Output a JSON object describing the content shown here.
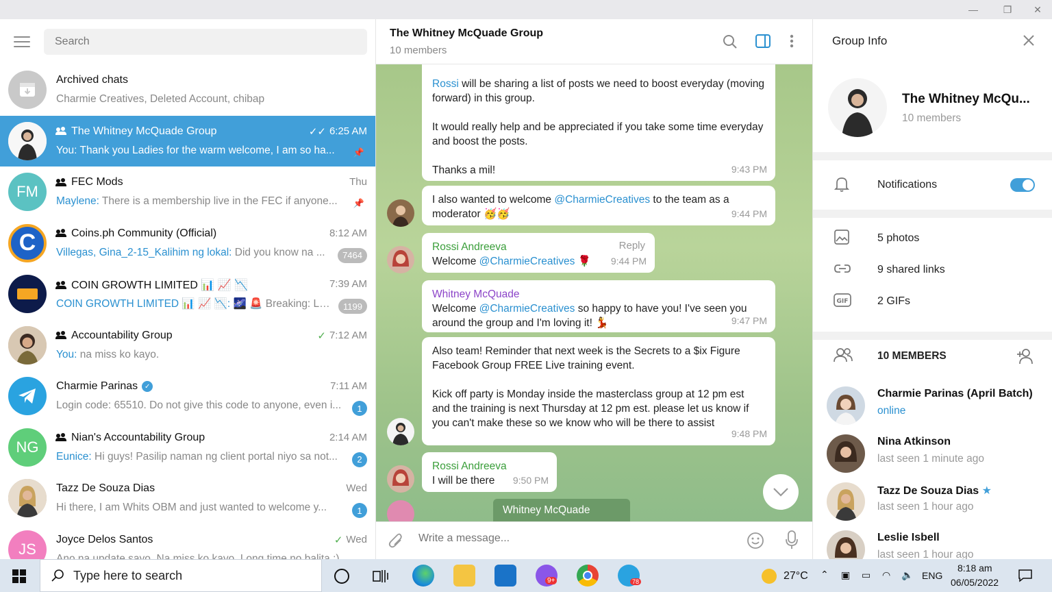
{
  "window": {
    "minimize": "—",
    "maximize": "❐",
    "close": "✕"
  },
  "left": {
    "search_placeholder": "Search",
    "chats": [
      {
        "title": "Archived chats",
        "preview": "Charmie Creatives, Deleted Account, chibap",
        "time": "",
        "badge": "",
        "sender": ""
      },
      {
        "title": "The Whitney McQuade Group",
        "preview": "Thank you Ladies for the warm welcome, I am so ha...",
        "sender": "You: ",
        "time": "6:25 AM",
        "badge": ""
      },
      {
        "title": "FEC Mods",
        "sender": "Maylene: ",
        "preview": "There is a membership live in the FEC if anyone...",
        "time": "Thu",
        "badge": "",
        "avatar_text": "FM"
      },
      {
        "title": "Coins.ph Community (Official)",
        "sender": "Villegas, Gina_2-15_Kalihim ng lokal: ",
        "preview": "Did you know na ...",
        "time": "8:12 AM",
        "badge": "7464"
      },
      {
        "title": "COIN GROWTH LIMITED 📊 📈 📉",
        "sender": "COIN GROWTH LIMITED 📊 📈 📉: ",
        "preview": "🌌 🚨 Breaking: Lu...",
        "time": "7:39 AM",
        "badge": "1199"
      },
      {
        "title": "Accountability Group",
        "sender": "You: ",
        "preview": "na miss ko kayo.",
        "time": "7:12 AM",
        "badge": ""
      },
      {
        "title": "Charmie Parinas",
        "sender": "",
        "preview": "Login code: 65510. Do not give this code to anyone, even i...",
        "time": "7:11 AM",
        "badge": "1"
      },
      {
        "title": "Nian's Accountability Group",
        "sender": "Eunice: ",
        "preview": "Hi guys! Pasilip naman ng client portal niyo sa not...",
        "time": "2:14 AM",
        "badge": "2",
        "avatar_text": "NG"
      },
      {
        "title": "Tazz De Souza Dias",
        "sender": "",
        "preview": "Hi there,   I am Whits OBM and just wanted to welcome y...",
        "time": "Wed",
        "badge": "1"
      },
      {
        "title": "Joyce Delos Santos",
        "sender": "",
        "preview": "Ano na update sayo. Na miss ko kayo. Long time no balita :)",
        "time": "Wed",
        "badge": "",
        "avatar_text": "JS"
      }
    ]
  },
  "middle": {
    "title": "The Whitney McQuade Group",
    "subtitle": "10 members",
    "messages": [
      {
        "mention": "Rossi",
        "text1": " will be sharing a list of posts we need to boost everyday (moving forward) in this group.",
        "text2": "It would really help and be appreciated if you take some time everyday and boost the posts.",
        "text3": "Thanks a mil!",
        "time": "9:43 PM"
      },
      {
        "text_a": "I also wanted to welcome ",
        "mention": "@CharmieCreatives",
        "text_b": " to the team as a moderator 🥳🥳",
        "time": "9:44 PM"
      },
      {
        "name": "Rossi Andreeva",
        "reply": "Reply",
        "text_a": "Welcome ",
        "mention": "@CharmieCreatives",
        "text_b": " 🌹",
        "time": "9:44 PM"
      },
      {
        "name": "Whitney McQuade",
        "text_a": "Welcome ",
        "mention": "@CharmieCreatives",
        "text_b": " so happy to have you! I've seen you around the group and I'm loving it! 💃",
        "time": "9:47 PM"
      },
      {
        "text1": "Also team! Reminder that next week is the Secrets to a $ix Figure Facebook Group FREE Live training event.",
        "text2": "Kick off party is Monday inside the masterclass group at 12 pm est and the training is next Thursday at 12 pm est. please let us know if you can't make these so we know who will be there to assist",
        "time": "9:48 PM"
      },
      {
        "name": "Rossi Andreeva",
        "text": "I will be there",
        "time": "9:50 PM"
      },
      {
        "name": "Whitney McQuade"
      }
    ],
    "composer_placeholder": "Write a message..."
  },
  "right": {
    "title": "Group Info",
    "group_name": "The Whitney McQu...",
    "group_members": "10 members",
    "notifications_label": "Notifications",
    "notifications_on": true,
    "media": [
      {
        "label": "5 photos",
        "icon": "photo-icon"
      },
      {
        "label": "9 shared links",
        "icon": "link-icon"
      },
      {
        "label": "2 GIFs",
        "icon": "gif-icon"
      }
    ],
    "members_header": "10 MEMBERS",
    "members": [
      {
        "name": "Charmie Parinas (April Batch)",
        "status": "online"
      },
      {
        "name": "Nina Atkinson",
        "status": "last seen 1 minute ago"
      },
      {
        "name": "Tazz De Souza Dias",
        "status": "last seen 1 hour ago"
      },
      {
        "name": "Leslie Isbell",
        "status": "last seen 1 hour ago"
      }
    ]
  },
  "taskbar": {
    "search_placeholder": "Type here to search",
    "temperature": "27°C",
    "language": "ENG",
    "time": "8:18 am",
    "date": "06/05/2022",
    "telegram_badge": "78",
    "messenger_badge": "9+"
  }
}
